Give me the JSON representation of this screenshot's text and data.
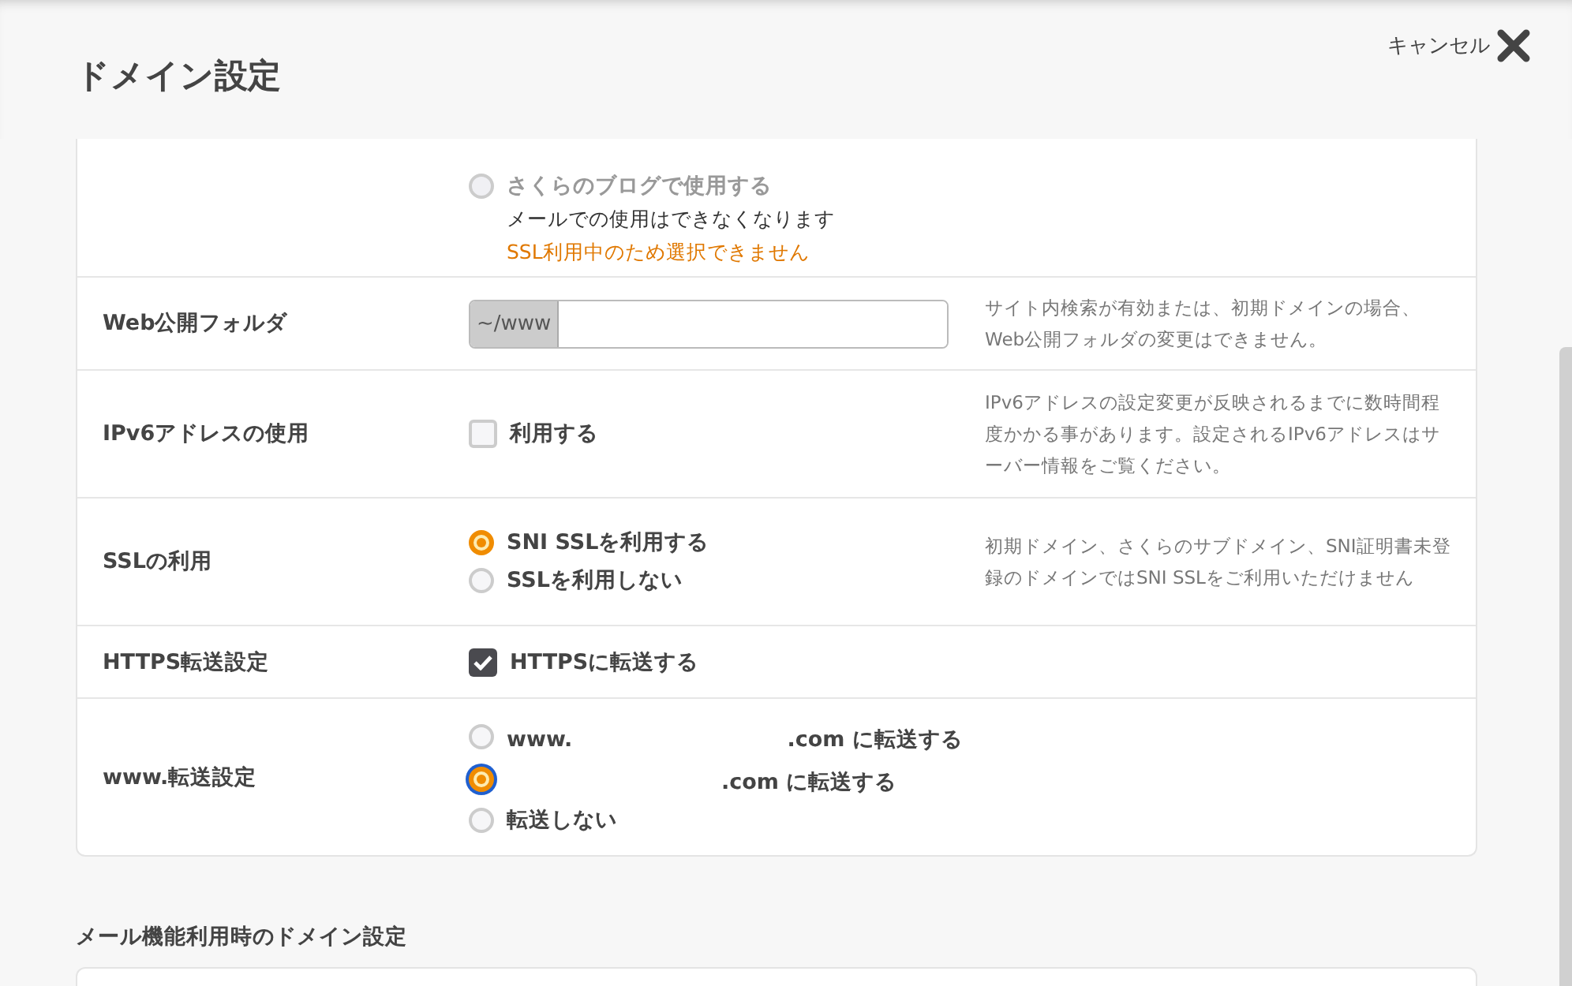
{
  "header": {
    "title": "ドメイン設定",
    "cancel": "キャンセル"
  },
  "blog_option": {
    "label": "さくらのブログで使用する",
    "selected": false,
    "disabled": true,
    "note": "メールでの使用はできなくなります",
    "warning": "SSL利用中のため選択できません"
  },
  "rows": [
    {
      "kind": "folder",
      "label": "Web公開フォルダ",
      "prefix": "~/www",
      "value": "",
      "note": "サイト内検索が有効または、初期ドメインの場合、Web公開フォルダの変更はできません。"
    },
    {
      "kind": "checkbox",
      "label": "IPv6アドレスの使用",
      "options": [
        {
          "label": "利用する",
          "checked": false
        }
      ],
      "note": "IPv6アドレスの設定変更が反映されるまでに数時間程度かかる事があります。設定されるIPv6アドレスはサーバー情報をご覧ください。"
    },
    {
      "kind": "radio",
      "label": "SSLの利用",
      "options": [
        {
          "label": "SNI SSLを利用する",
          "selected": true,
          "focused": false
        },
        {
          "label": "SSLを利用しない",
          "selected": false,
          "focused": false
        }
      ],
      "note": "初期ドメイン、さくらのサブドメイン、SNI証明書未登録のドメインではSNI SSLをご利用いただけません"
    },
    {
      "kind": "checkbox",
      "label": "HTTPS転送設定",
      "options": [
        {
          "label": "HTTPSに転送する",
          "checked": true
        }
      ]
    },
    {
      "kind": "radio",
      "label": "www.転送設定",
      "options": [
        {
          "prefix": "www.",
          "redacted": true,
          "label": ".com に転送する",
          "selected": false,
          "focused": false
        },
        {
          "redacted": true,
          "label": ".com に転送する",
          "selected": true,
          "focused": true
        },
        {
          "label": "転送しない",
          "selected": false,
          "focused": false
        }
      ]
    }
  ],
  "next_section": {
    "title": "メール機能利用時のドメイン設定"
  }
}
